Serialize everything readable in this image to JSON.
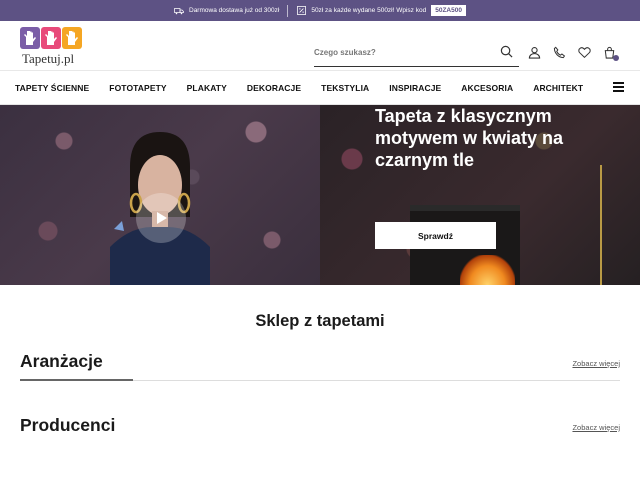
{
  "promo": {
    "shipping_text": "Darmowa dostawa już od 300zł",
    "discount_text": "50zł za każde wydane 500zł! Wpisz kod",
    "code": "50ZA500"
  },
  "header": {
    "logo_text": "Tapetuj.pl",
    "search_placeholder": "Czego szukasz?"
  },
  "nav": {
    "items": [
      "TAPETY ŚCIENNE",
      "FOTOTAPETY",
      "PLAKATY",
      "DEKORACJE",
      "TEKSTYLIA",
      "INSPIRACJE",
      "AKCESORIA",
      "ARCHITEKT"
    ]
  },
  "hero": {
    "title": "Tapeta z klasycznym motywem w kwiaty na czarnym tle",
    "button": "Sprawdź"
  },
  "main": {
    "section_title": "Sklep z tapetami",
    "blocks": [
      {
        "title": "Aranżacje",
        "more": "Zobacz więcej"
      },
      {
        "title": "Producenci",
        "more": "Zobacz więcej"
      }
    ]
  },
  "colors": {
    "accent": "#5d5284",
    "logo_purple": "#7b5ea7",
    "logo_pink": "#e84a7a",
    "logo_orange": "#f5a623"
  }
}
